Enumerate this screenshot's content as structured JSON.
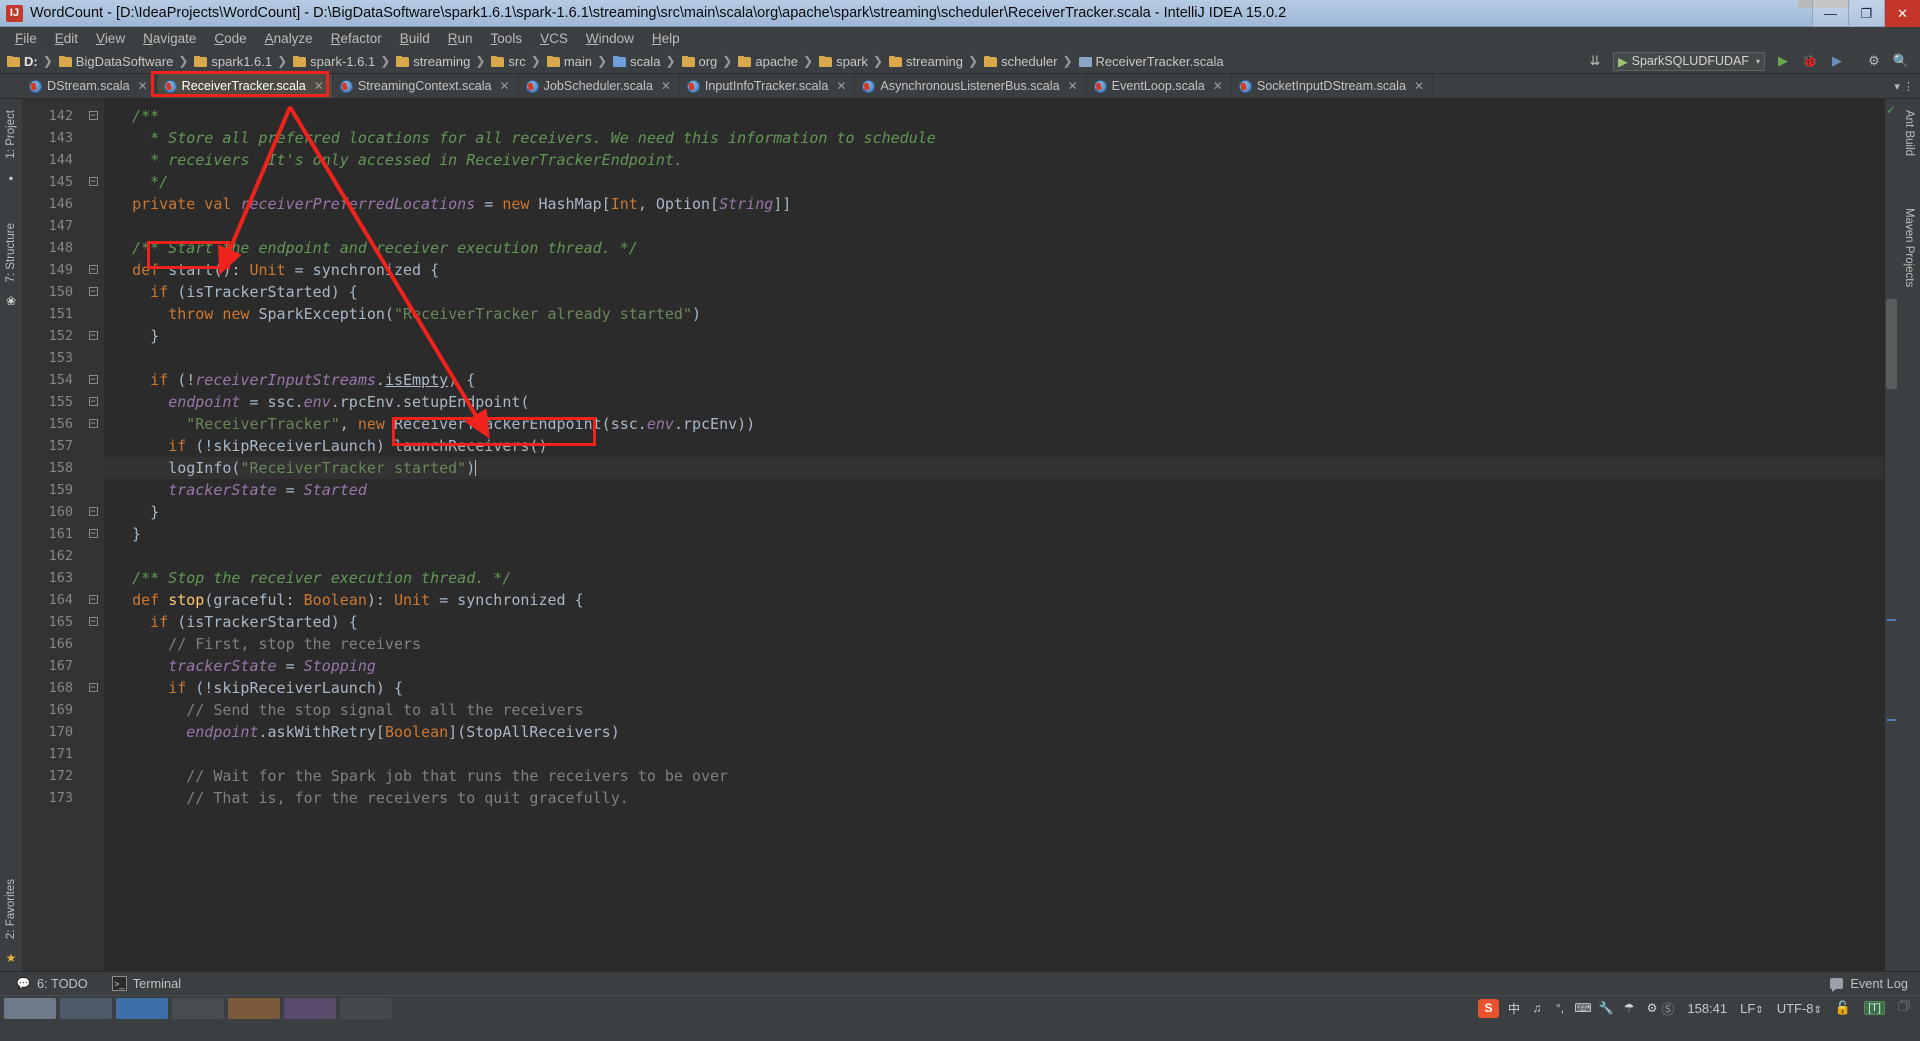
{
  "window": {
    "app_icon_letter": "IJ",
    "title": "WordCount - [D:\\IdeaProjects\\WordCount] - D:\\BigDataSoftware\\spark1.6.1\\spark-1.6.1\\streaming\\src\\main\\scala\\org\\apache\\spark\\streaming\\scheduler\\ReceiverTracker.scala - IntelliJ IDEA 15.0.2",
    "minimize": "—",
    "maximize": "❐",
    "close": "✕"
  },
  "menu": {
    "items": [
      "File",
      "Edit",
      "View",
      "Navigate",
      "Code",
      "Analyze",
      "Refactor",
      "Build",
      "Run",
      "Tools",
      "VCS",
      "Window",
      "Help"
    ]
  },
  "navbar": {
    "crumbs": [
      {
        "label": "D:",
        "kind": "folder"
      },
      {
        "label": "BigDataSoftware",
        "kind": "folder"
      },
      {
        "label": "spark1.6.1",
        "kind": "folder"
      },
      {
        "label": "spark-1.6.1",
        "kind": "folder"
      },
      {
        "label": "streaming",
        "kind": "folder"
      },
      {
        "label": "src",
        "kind": "folder"
      },
      {
        "label": "main",
        "kind": "folder"
      },
      {
        "label": "scala",
        "kind": "source"
      },
      {
        "label": "org",
        "kind": "folder"
      },
      {
        "label": "apache",
        "kind": "folder"
      },
      {
        "label": "spark",
        "kind": "folder"
      },
      {
        "label": "streaming",
        "kind": "folder"
      },
      {
        "label": "scheduler",
        "kind": "folder"
      },
      {
        "label": "ReceiverTracker.scala",
        "kind": "file"
      }
    ],
    "run_config": "SparkSQLUDFUDAF",
    "run_config_arrow": "▾",
    "icons": {
      "update_project": "⇊",
      "run": "▶",
      "debug": "🐞",
      "coverage": "▶",
      "attach": "⏵",
      "settings": "⚙",
      "search": "🔍"
    }
  },
  "tabs": [
    {
      "label": "DStream.scala",
      "active": false
    },
    {
      "label": "ReceiverTracker.scala",
      "active": true
    },
    {
      "label": "StreamingContext.scala",
      "active": false
    },
    {
      "label": "JobScheduler.scala",
      "active": false
    },
    {
      "label": "InputInfoTracker.scala",
      "active": false
    },
    {
      "label": "AsynchronousListenerBus.scala",
      "active": false
    },
    {
      "label": "EventLoop.scala",
      "active": false
    },
    {
      "label": "SocketInputDStream.scala",
      "active": false
    }
  ],
  "left_rail": {
    "project_tab": "1: Project",
    "structure_tab": "7: Structure",
    "favorites_tab": "2: Favorites"
  },
  "right_rail": {
    "ant_build_tab": "Ant Build",
    "maven_tab": "Maven Projects"
  },
  "editor": {
    "first_line_number": 142,
    "lines": [
      {
        "n": 142,
        "fold": "open",
        "segments": [
          {
            "t": "  /**",
            "c": "cmt"
          }
        ]
      },
      {
        "n": 143,
        "fold": "",
        "segments": [
          {
            "t": "    * Store all preferred locations for all receivers. We need this information to schedule",
            "c": "cmt"
          }
        ]
      },
      {
        "n": 144,
        "fold": "",
        "segments": [
          {
            "t": "    * receivers  It's only accessed in ReceiverTrackerEndpoint.",
            "c": "cmt"
          }
        ]
      },
      {
        "n": 145,
        "fold": "close",
        "segments": [
          {
            "t": "    */",
            "c": "cmt"
          }
        ]
      },
      {
        "n": 146,
        "fold": "",
        "segments": [
          {
            "t": "  ",
            "c": ""
          },
          {
            "t": "private val",
            "c": "kw"
          },
          {
            "t": " ",
            "c": ""
          },
          {
            "t": "receiverPreferredLocations",
            "c": "fld"
          },
          {
            "t": " = ",
            "c": ""
          },
          {
            "t": "new",
            "c": "kw"
          },
          {
            "t": " HashMap[",
            "c": "typ"
          },
          {
            "t": "Int",
            "c": "kw"
          },
          {
            "t": ", Option[",
            "c": "typ"
          },
          {
            "t": "String",
            "c": "fld"
          },
          {
            "t": "]]",
            "c": "typ"
          }
        ]
      },
      {
        "n": 147,
        "fold": "",
        "segments": [
          {
            "t": "",
            "c": ""
          }
        ]
      },
      {
        "n": 148,
        "fold": "",
        "segments": [
          {
            "t": "  /** Start the endpoint and receiver execution thread. */",
            "c": "cmt"
          }
        ]
      },
      {
        "n": 149,
        "fold": "open",
        "segments": [
          {
            "t": "  ",
            "c": ""
          },
          {
            "t": "def",
            "c": "kw"
          },
          {
            "t": " ",
            "c": ""
          },
          {
            "t": "start",
            "c": "typ"
          },
          {
            "t": "(): ",
            "c": "typ"
          },
          {
            "t": "Unit",
            "c": "kw"
          },
          {
            "t": " = synchronized {",
            "c": "typ"
          }
        ]
      },
      {
        "n": 150,
        "fold": "open",
        "segments": [
          {
            "t": "    ",
            "c": ""
          },
          {
            "t": "if",
            "c": "kw"
          },
          {
            "t": " (isTrackerStarted) {",
            "c": "typ"
          }
        ]
      },
      {
        "n": 151,
        "fold": "",
        "segments": [
          {
            "t": "      ",
            "c": ""
          },
          {
            "t": "throw new",
            "c": "kw"
          },
          {
            "t": " SparkException(",
            "c": "typ"
          },
          {
            "t": "\"ReceiverTracker already started\"",
            "c": "str"
          },
          {
            "t": ")",
            "c": "typ"
          }
        ]
      },
      {
        "n": 152,
        "fold": "close",
        "segments": [
          {
            "t": "    }",
            "c": "typ"
          }
        ]
      },
      {
        "n": 153,
        "fold": "",
        "segments": [
          {
            "t": "",
            "c": ""
          }
        ]
      },
      {
        "n": 154,
        "fold": "open",
        "segments": [
          {
            "t": "    ",
            "c": ""
          },
          {
            "t": "if",
            "c": "kw"
          },
          {
            "t": " (!",
            "c": "typ"
          },
          {
            "t": "receiverInputStreams",
            "c": "fld"
          },
          {
            "t": ".",
            "c": "typ"
          },
          {
            "t": "isEmpty",
            "c": "ul"
          },
          {
            "t": ") {",
            "c": "typ"
          }
        ]
      },
      {
        "n": 155,
        "fold": "open",
        "segments": [
          {
            "t": "      ",
            "c": ""
          },
          {
            "t": "endpoint",
            "c": "fld"
          },
          {
            "t": " = ssc.",
            "c": "typ"
          },
          {
            "t": "env",
            "c": "fld"
          },
          {
            "t": ".rpcEnv.setupEndpoint(",
            "c": "typ"
          }
        ]
      },
      {
        "n": 156,
        "fold": "close",
        "segments": [
          {
            "t": "        ",
            "c": ""
          },
          {
            "t": "\"ReceiverTracker\"",
            "c": "str"
          },
          {
            "t": ", ",
            "c": "typ"
          },
          {
            "t": "new",
            "c": "kw"
          },
          {
            "t": " ReceiverTrackerEndpoint(ssc.",
            "c": "typ"
          },
          {
            "t": "env",
            "c": "fld"
          },
          {
            "t": ".rpcEnv))",
            "c": "typ"
          }
        ]
      },
      {
        "n": 157,
        "fold": "",
        "segments": [
          {
            "t": "      ",
            "c": ""
          },
          {
            "t": "if",
            "c": "kw"
          },
          {
            "t": " (!skipReceiverLaunch) launchReceivers()",
            "c": "typ"
          }
        ]
      },
      {
        "n": 158,
        "fold": "",
        "caret": true,
        "segments": [
          {
            "t": "      logInfo(",
            "c": "typ"
          },
          {
            "t": "\"ReceiverTracker started\"",
            "c": "str"
          },
          {
            "t": ")",
            "c": "typ"
          }
        ]
      },
      {
        "n": 159,
        "fold": "",
        "segments": [
          {
            "t": "      ",
            "c": ""
          },
          {
            "t": "trackerState",
            "c": "fld"
          },
          {
            "t": " = ",
            "c": "typ"
          },
          {
            "t": "Started",
            "c": "fld"
          }
        ]
      },
      {
        "n": 160,
        "fold": "close",
        "segments": [
          {
            "t": "    }",
            "c": "typ"
          }
        ]
      },
      {
        "n": 161,
        "fold": "close",
        "segments": [
          {
            "t": "  }",
            "c": "typ"
          }
        ]
      },
      {
        "n": 162,
        "fold": "",
        "segments": [
          {
            "t": "",
            "c": ""
          }
        ]
      },
      {
        "n": 163,
        "fold": "",
        "segments": [
          {
            "t": "  /** Stop the receiver execution thread. */",
            "c": "cmt"
          }
        ]
      },
      {
        "n": 164,
        "fold": "open",
        "segments": [
          {
            "t": "  ",
            "c": ""
          },
          {
            "t": "def",
            "c": "kw"
          },
          {
            "t": " ",
            "c": ""
          },
          {
            "t": "stop",
            "c": "mth"
          },
          {
            "t": "(graceful: ",
            "c": "typ"
          },
          {
            "t": "Boolean",
            "c": "kw"
          },
          {
            "t": "): ",
            "c": "typ"
          },
          {
            "t": "Unit",
            "c": "kw"
          },
          {
            "t": " = synchronized {",
            "c": "typ"
          }
        ]
      },
      {
        "n": 165,
        "fold": "open",
        "segments": [
          {
            "t": "    ",
            "c": ""
          },
          {
            "t": "if",
            "c": "kw"
          },
          {
            "t": " (isTrackerStarted) {",
            "c": "typ"
          }
        ]
      },
      {
        "n": 166,
        "fold": "",
        "segments": [
          {
            "t": "      // First, stop the receivers",
            "c": "lcmt"
          }
        ]
      },
      {
        "n": 167,
        "fold": "",
        "segments": [
          {
            "t": "      ",
            "c": ""
          },
          {
            "t": "trackerState",
            "c": "fld"
          },
          {
            "t": " = ",
            "c": "typ"
          },
          {
            "t": "Stopping",
            "c": "fld"
          }
        ]
      },
      {
        "n": 168,
        "fold": "open",
        "segments": [
          {
            "t": "      ",
            "c": ""
          },
          {
            "t": "if",
            "c": "kw"
          },
          {
            "t": " (!skipReceiverLaunch) {",
            "c": "typ"
          }
        ]
      },
      {
        "n": 169,
        "fold": "",
        "segments": [
          {
            "t": "        // Send the stop signal to all the receivers",
            "c": "lcmt"
          }
        ]
      },
      {
        "n": 170,
        "fold": "",
        "segments": [
          {
            "t": "        ",
            "c": ""
          },
          {
            "t": "endpoint",
            "c": "fld"
          },
          {
            "t": ".askWithRetry[",
            "c": "typ"
          },
          {
            "t": "Boolean",
            "c": "kw"
          },
          {
            "t": "](StopAllReceivers)",
            "c": "typ"
          }
        ]
      },
      {
        "n": 171,
        "fold": "",
        "segments": [
          {
            "t": "",
            "c": ""
          }
        ]
      },
      {
        "n": 172,
        "fold": "",
        "segments": [
          {
            "t": "        // Wait for the Spark job that runs the receivers to be over",
            "c": "lcmt"
          }
        ]
      },
      {
        "n": 173,
        "fold": "",
        "segments": [
          {
            "t": "        // That is, for the receivers to quit gracefully.",
            "c": "lcmt"
          }
        ]
      }
    ]
  },
  "annotations": {
    "box_tab_label": "ReceiverTracker.scala",
    "box_start_label": "start():",
    "box_launch_label": "launchReceivers()",
    "arrow_color": "#f0231c"
  },
  "tool_window_bar": {
    "todo": "6: TODO",
    "todo_number": "6",
    "terminal": "Terminal",
    "event_log": "Event Log"
  },
  "status_bar": {
    "caret_position": "158:41",
    "line_separator": "LF",
    "encoding": "UTF-8",
    "lock_icon": "🔓",
    "t_badge": "[T]",
    "ime_language": "中",
    "sogou_letter": "S"
  }
}
